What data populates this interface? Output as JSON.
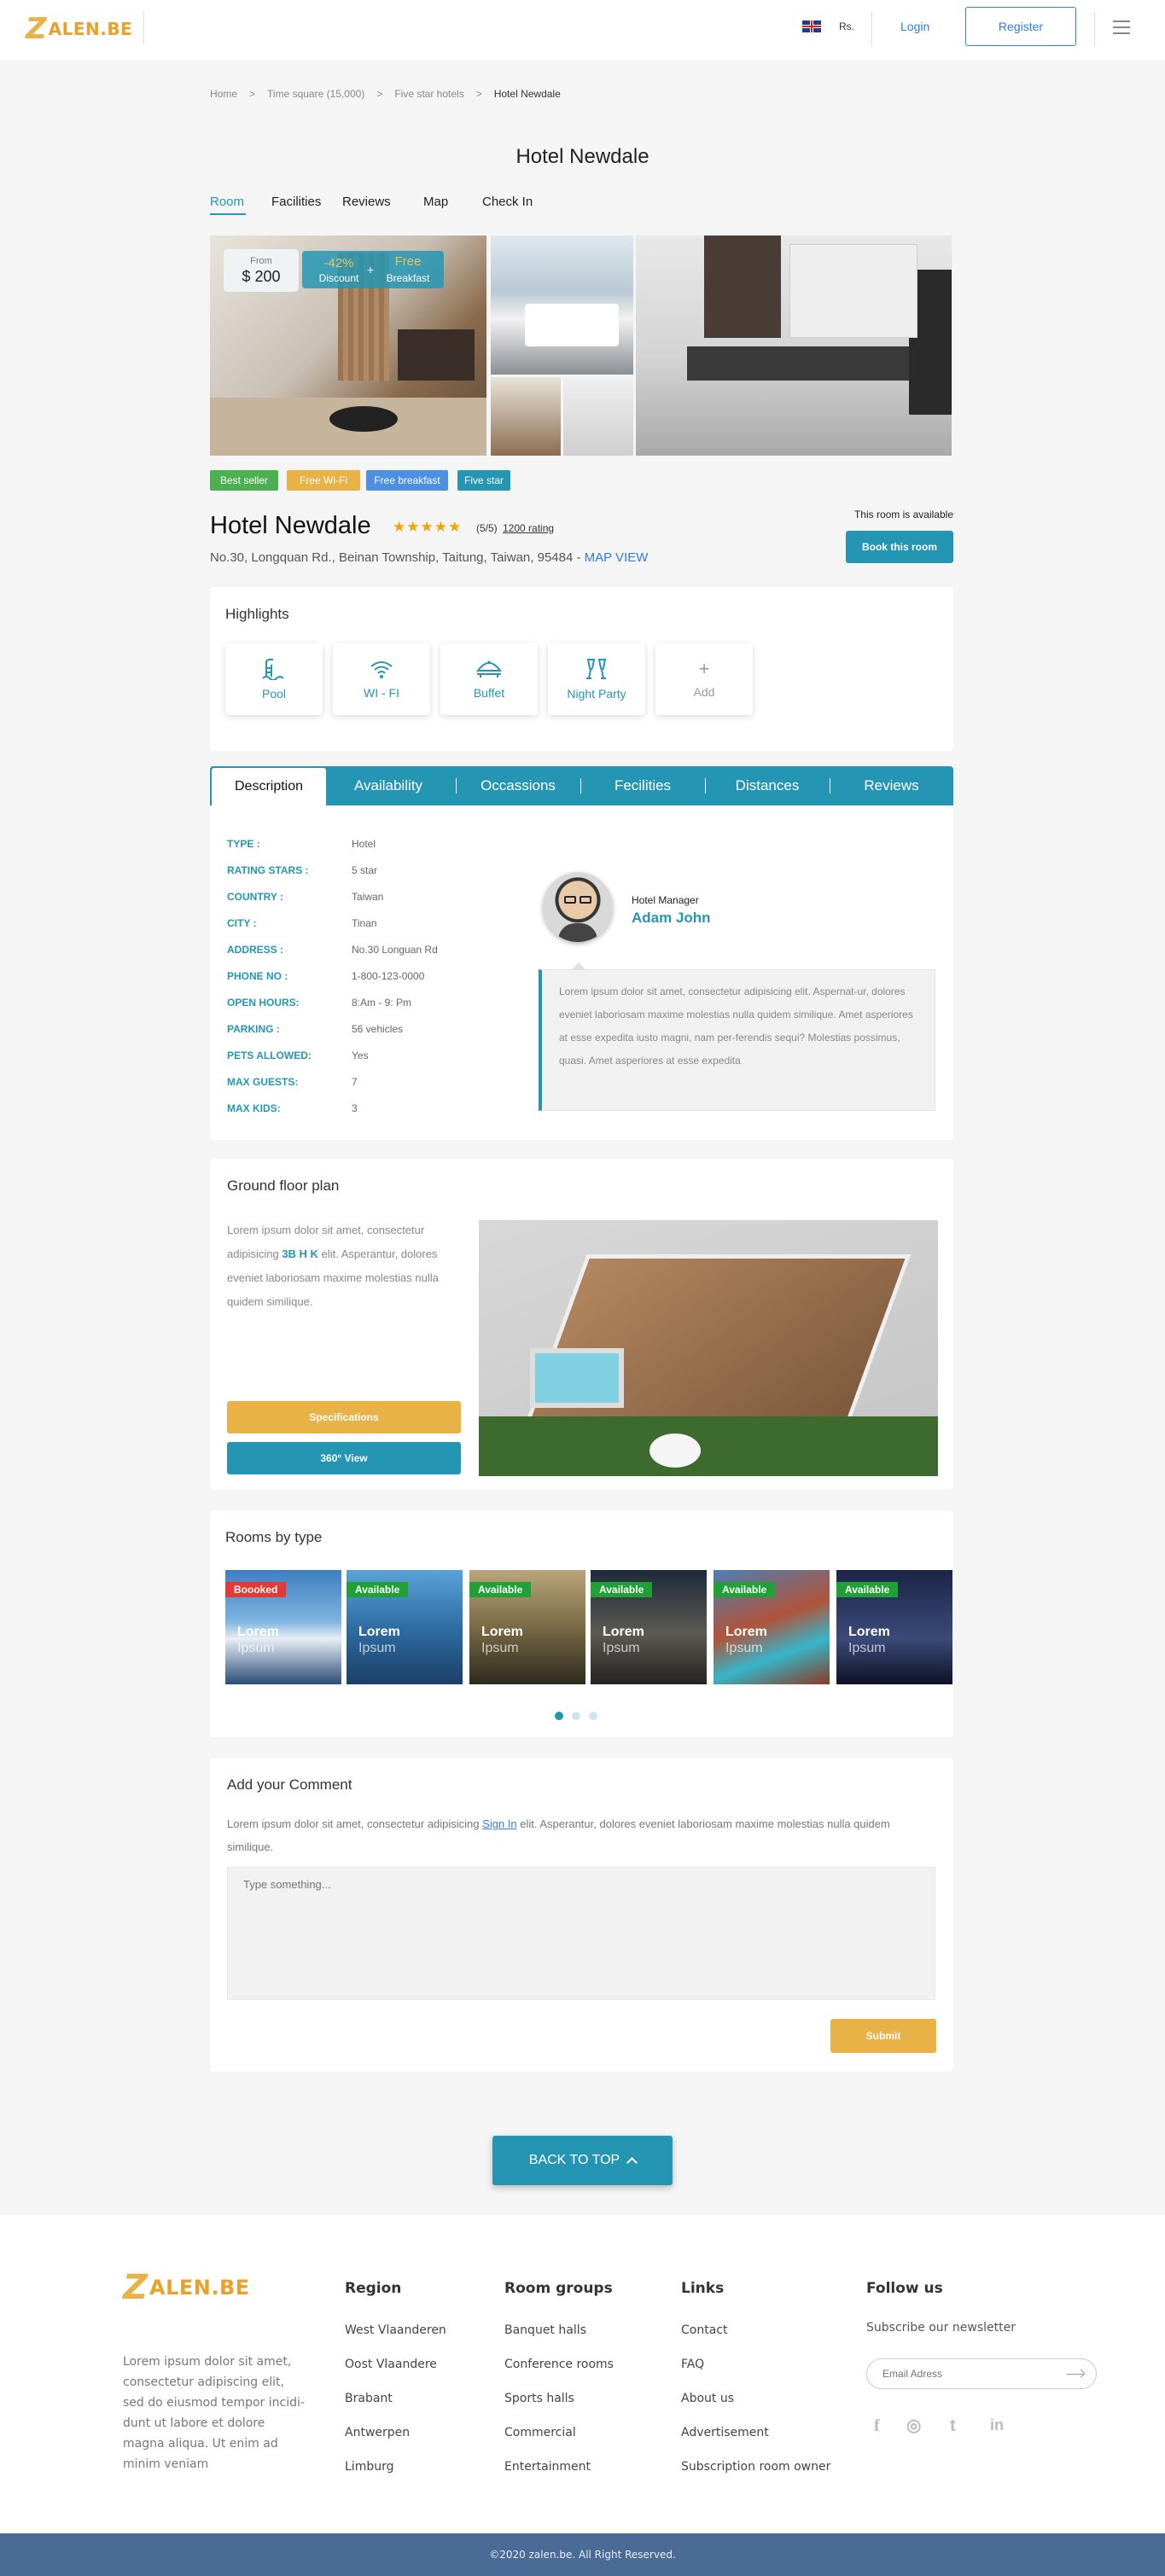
{
  "header": {
    "logo_z": "Z",
    "logo_text": "ALEN.BE",
    "currency": "Rs.",
    "login": "Login",
    "register": "Register"
  },
  "breadcrumb": [
    "Home",
    "Time square (15,000)",
    "Five star hotels",
    "Hotel Newdale"
  ],
  "breadcrumb_sep": ">",
  "page_title": "Hotel Newdale",
  "top_tabs": [
    "Room",
    "Facilities",
    "Reviews",
    "Map",
    "Check In"
  ],
  "promo": {
    "from_label": "From",
    "price": "$ 200",
    "discount_value": "-42%",
    "discount_label": "Discount",
    "plus": "+",
    "free_value": "Free",
    "free_label": "Breakfast"
  },
  "badges": [
    {
      "label": "Best seller",
      "color": "#4caf50"
    },
    {
      "label": "Free Wi-Fi",
      "color": "#e8b246"
    },
    {
      "label": "Free breakfast",
      "color": "#4d8fe0"
    },
    {
      "label": "Five star",
      "color": "#2496b4"
    }
  ],
  "hotel": {
    "name": "Hotel Newdale",
    "stars": "★★★★★",
    "rating_text": "(5/5)",
    "rating_link": "1200 rating",
    "address": "No.30, Longquan Rd., Beinan Township, Taitung, Taiwan, 95484 -",
    "map_link": "MAP VIEW",
    "availability": "This room is available",
    "book_button": "Book this room"
  },
  "highlights": {
    "title": "Highlights",
    "items": [
      {
        "label": "Pool",
        "icon": "pool-icon"
      },
      {
        "label": "WI - FI",
        "icon": "wifi-icon"
      },
      {
        "label": "Buffet",
        "icon": "buffet-icon"
      },
      {
        "label": "Night Party",
        "icon": "party-icon"
      },
      {
        "label": "Add",
        "icon": "plus-icon"
      }
    ]
  },
  "detail_tabs": [
    "Description",
    "Availability",
    "Occassions",
    "Fecilities",
    "Distances",
    "Reviews"
  ],
  "details": [
    {
      "key": "TYPE :",
      "value": "Hotel"
    },
    {
      "key": "RATING STARS :",
      "value": "5 star"
    },
    {
      "key": "COUNTRY :",
      "value": "Taiwan"
    },
    {
      "key": "CITY :",
      "value": "Tinan"
    },
    {
      "key": "ADDRESS :",
      "value": "No.30 Longuan Rd"
    },
    {
      "key": "PHONE NO :",
      "value": "1-800-123-0000"
    },
    {
      "key": "OPEN HOURS:",
      "value": "8:Am - 9: Pm"
    },
    {
      "key": "PARKING :",
      "value": "56 vehicles"
    },
    {
      "key": "PETS ALLOWED:",
      "value": "Yes"
    },
    {
      "key": "MAX GUESTS:",
      "value": "7"
    },
    {
      "key": "MAX KIDS:",
      "value": "3"
    }
  ],
  "manager": {
    "role": "Hotel Manager",
    "name": "Adam John",
    "quote": "Lorem ipsum dolor sit amet, consectetur adipisicing elit. Aspernat-ur, dolores eveniet laboriosam maxime molestias nulla quidem similique. Amet asperiores at esse expedita iusto magni, nam per-ferendis sequi? Molestias possimus, quasi. Amet asperiores at esse expedita"
  },
  "floor_plan": {
    "title": "Ground floor plan",
    "text_before": "Lorem ipsum dolor sit amet, consectetur adipisicing",
    "highlight": "3B H K",
    "text_after": "elit. Asperantur, dolores eveniet laboriosam maxime molestias nulla quidem similique.",
    "spec_button": "Specifications",
    "view_button": "360° View"
  },
  "rooms": {
    "title": "Rooms by type",
    "items": [
      {
        "status": "Boooked",
        "status_color": "#e53935",
        "l1": "Lorem",
        "l2": "Ipsum"
      },
      {
        "status": "Available",
        "status_color": "#21a038",
        "l1": "Lorem",
        "l2": "Ipsum"
      },
      {
        "status": "Available",
        "status_color": "#21a038",
        "l1": "Lorem",
        "l2": "Ipsum"
      },
      {
        "status": "Available",
        "status_color": "#21a038",
        "l1": "Lorem",
        "l2": "Ipsum"
      },
      {
        "status": "Available",
        "status_color": "#21a038",
        "l1": "Lorem",
        "l2": "Ipsum"
      },
      {
        "status": "Available",
        "status_color": "#21a038",
        "l1": "Lorem",
        "l2": "Ipsum"
      }
    ]
  },
  "comment": {
    "title": "Add your Comment",
    "text_before": "Lorem ipsum dolor sit amet, consectetur adipisicing",
    "sign_in": "Sign In",
    "text_after": "elit. Asperantur, dolores eveniet laboriosam maxime molestias nulla quidem similique.",
    "placeholder": "Type something...",
    "submit": "Submit"
  },
  "back_to_top": "BACK TO TOP",
  "footer": {
    "logo_z": "Z",
    "logo_text": "ALEN.BE",
    "about": [
      "Lorem ipsum dolor sit amet,",
      "consectetur adipiscing elit,",
      "sed do eiusmod tempor incidi-",
      "dunt ut labore et dolore",
      "magna aliqua. Ut enim ad",
      "minim veniam"
    ],
    "region_title": "Region",
    "regions": [
      "West Vlaanderen",
      "Oost Vlaandere",
      "Brabant",
      "Antwerpen",
      "Limburg"
    ],
    "groups_title": "Room groups",
    "groups": [
      "Banquet halls",
      "Conference rooms",
      "Sports halls",
      "Commercial",
      "Entertainment"
    ],
    "links_title": "Links",
    "links": [
      "Contact",
      "FAQ",
      "About us",
      "Advertisement",
      "Subscription room owner"
    ],
    "follow_title": "Follow us",
    "newsletter": "Subscribe our newsletter",
    "email_placeholder": "Email Adress",
    "social": [
      "f",
      "◎",
      "t",
      "in"
    ],
    "copyright": "©2020 zalen.be. All Right Reserved."
  },
  "colors": {
    "accent": "#2496b4",
    "gold": "#e8b246",
    "link": "#2d7ee0",
    "footer_bar": "#4a6b95"
  }
}
